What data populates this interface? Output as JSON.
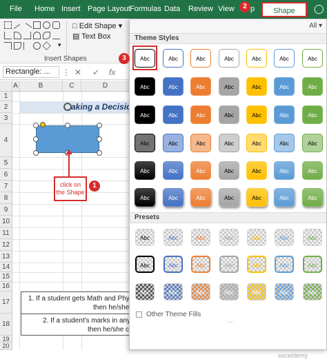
{
  "ribbon": {
    "tabs": [
      {
        "label": "File"
      },
      {
        "label": "Home"
      },
      {
        "label": "Insert"
      },
      {
        "label": "Page Layout"
      },
      {
        "label": "Formulas"
      },
      {
        "label": "Data"
      },
      {
        "label": "Review"
      },
      {
        "label": "View"
      },
      {
        "label": "p"
      }
    ],
    "active_tab": "Shape Format",
    "edit_shape_label": "Edit Shape",
    "text_box_label": "Text Box",
    "group_label": "Insert Shapes",
    "accent_color": "#217346"
  },
  "formula_bar": {
    "name_box": "Rectangle: ...",
    "fx_label": "fx",
    "cancel": "✕",
    "enter": "✓"
  },
  "grid": {
    "columns": [
      "A",
      "B",
      "C",
      "D"
    ],
    "rows": [
      "1",
      "2",
      "3",
      "4",
      "5",
      "6",
      "7",
      "8",
      "9",
      "10",
      "11",
      "12",
      "13",
      "14",
      "15",
      "16",
      "17",
      "18",
      "19",
      "20"
    ]
  },
  "sheet": {
    "title": "aking a Decision",
    "callout": "click on the Shape",
    "condition_1_line1": "1. If a student gets Math and Physics S",
    "condition_1_line2": "then he/she c",
    "condition_2_line1": "2. If a student's marks in any of th",
    "condition_2_line2": "then he/she cannot apply"
  },
  "steps": [
    "1",
    "2",
    "3"
  ],
  "gallery": {
    "filter_label": "All",
    "theme_styles_label": "Theme Styles",
    "presets_label": "Presets",
    "swatch_text": "Abc",
    "other_fills_label": "Other Theme Fills",
    "watermark": "exceldemy",
    "colors": [
      "#000000",
      "#4472c4",
      "#ed7d31",
      "#a5a5a5",
      "#ffc000",
      "#5b9bd5",
      "#70ad47"
    ],
    "selected_style": "Colored Fill - Blue, Accent 5"
  }
}
